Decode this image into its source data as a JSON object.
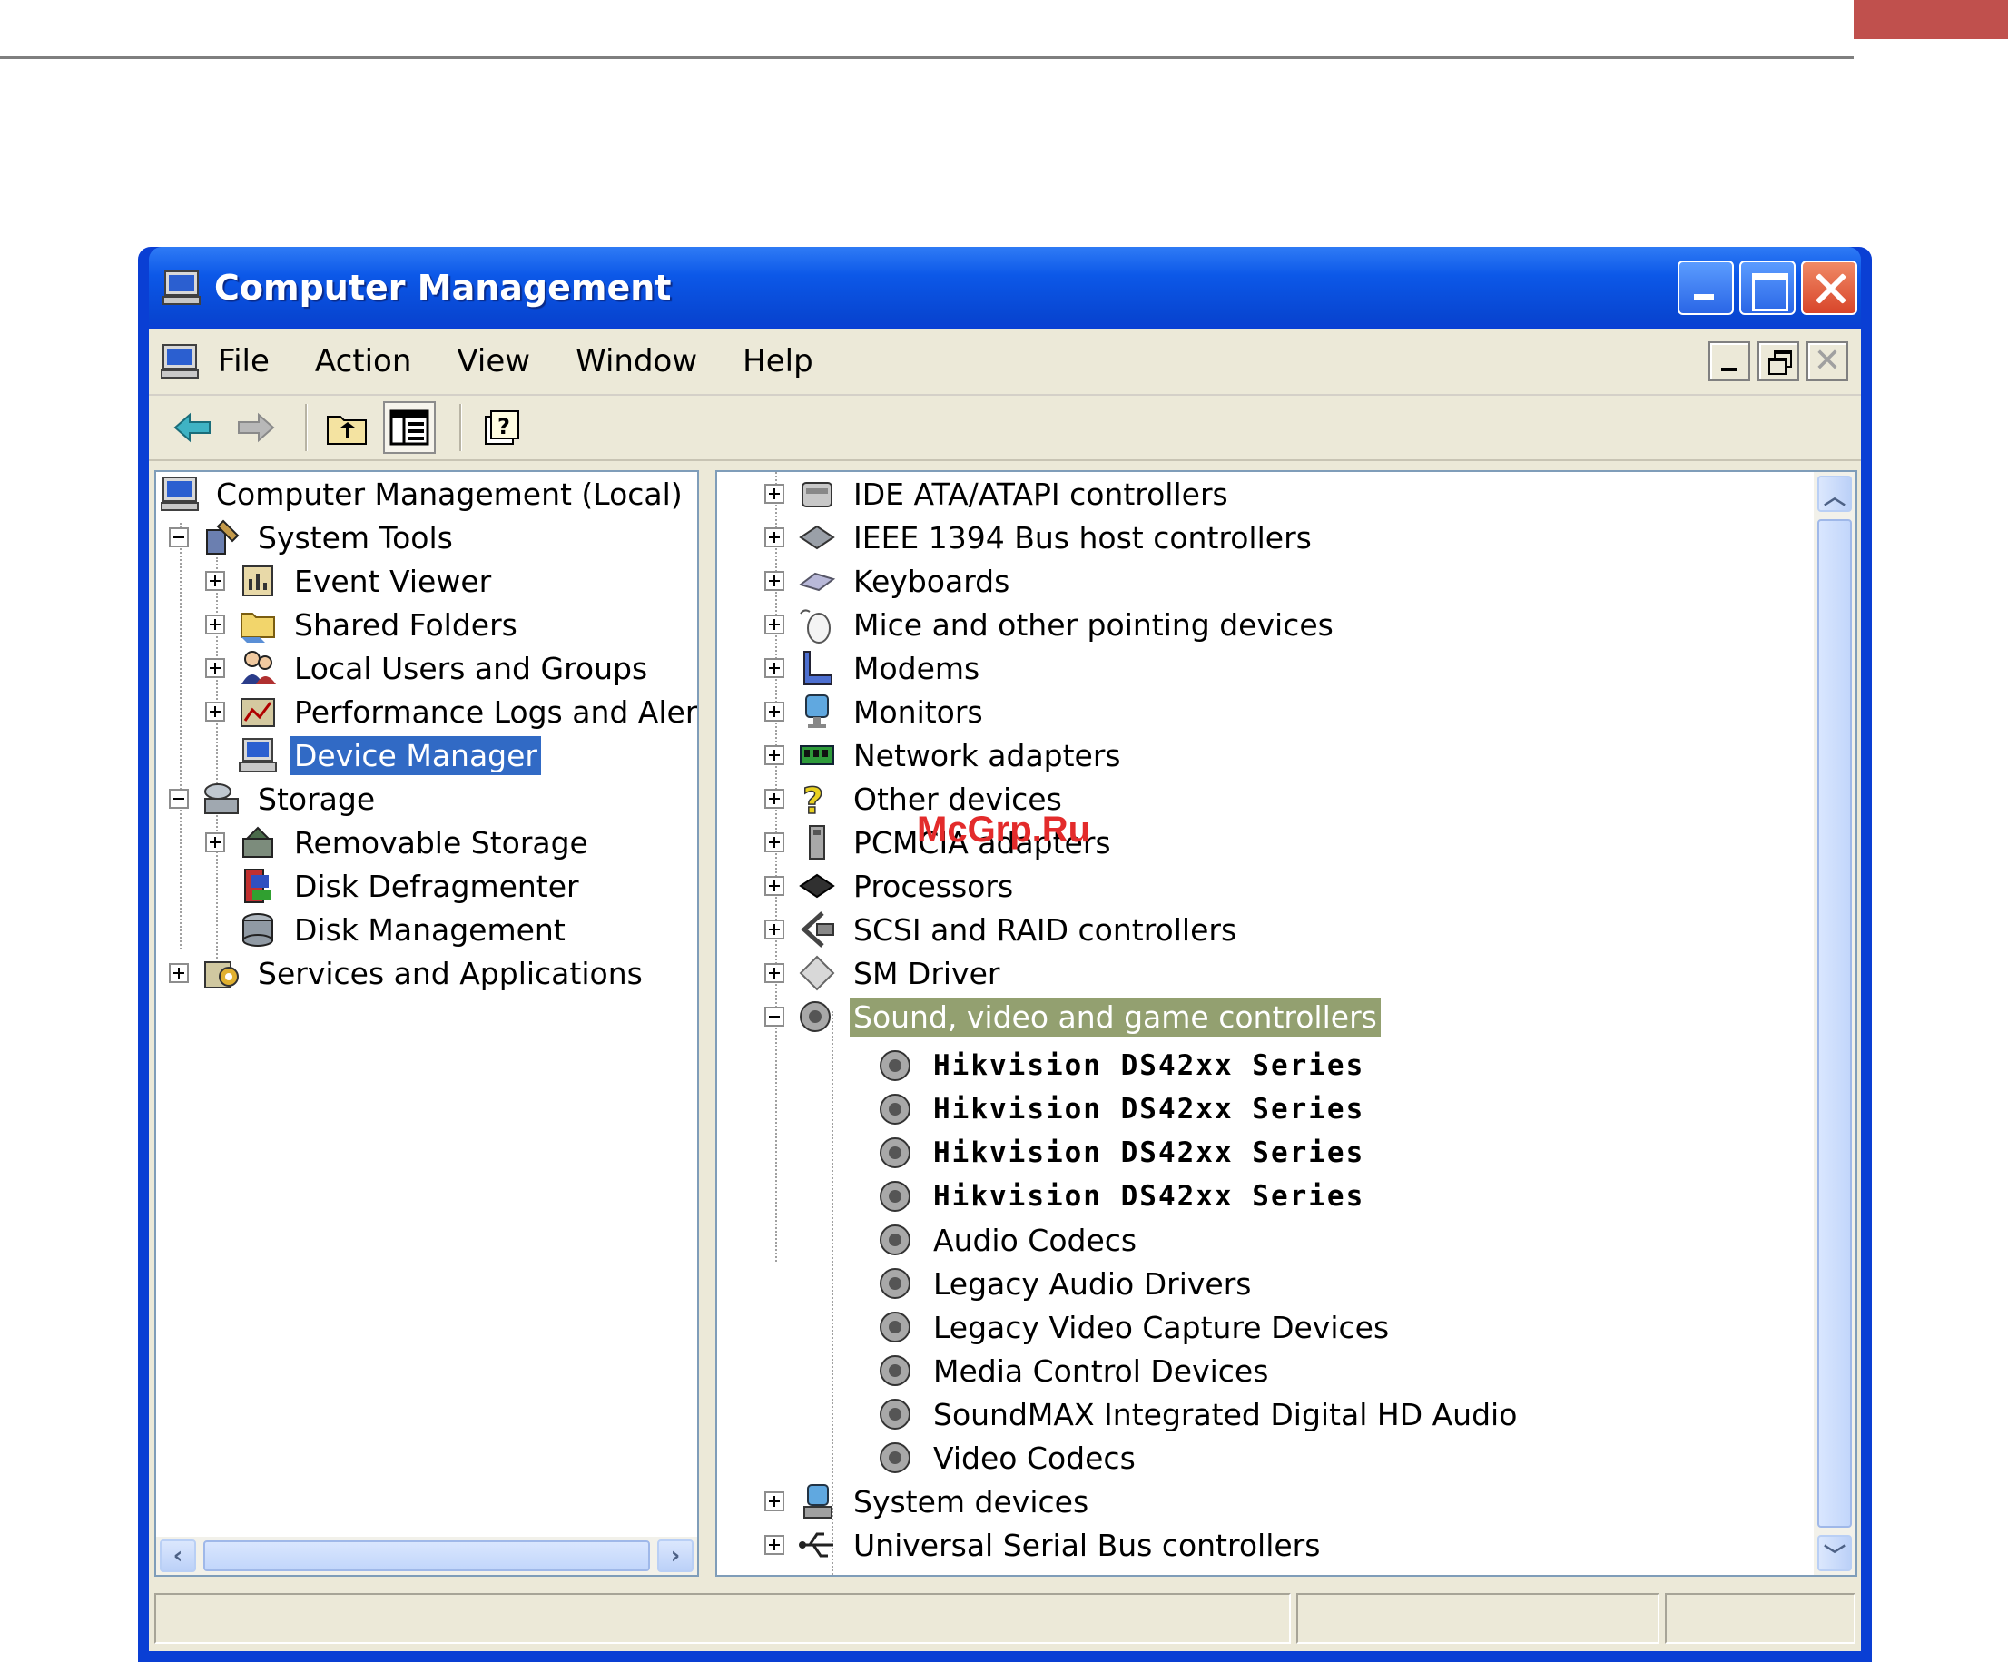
{
  "window": {
    "title": "Computer Management"
  },
  "menubar": {
    "items": [
      "File",
      "Action",
      "View",
      "Window",
      "Help"
    ]
  },
  "toolbar": {
    "buttons": [
      "back-arrow-icon",
      "forward-arrow-icon",
      "up-folder-icon",
      "show-hide-tree-icon",
      "help-icon"
    ]
  },
  "left_tree": {
    "root": "Computer Management (Local)",
    "system_tools": "System Tools",
    "event_viewer": "Event Viewer",
    "shared_folders": "Shared Folders",
    "local_users": "Local Users and Groups",
    "perf_logs": "Performance Logs and Alerts",
    "device_manager": "Device Manager",
    "storage": "Storage",
    "removable_storage": "Removable Storage",
    "disk_defrag": "Disk Defragmenter",
    "disk_mgmt": "Disk Management",
    "services_apps": "Services and Applications"
  },
  "device_tree": {
    "categories_top": [
      "IDE ATA/ATAPI controllers",
      "IEEE 1394 Bus host controllers",
      "Keyboards",
      "Mice and other pointing devices",
      "Modems",
      "Monitors",
      "Network adapters",
      "Other devices",
      "PCMCIA adapters",
      "Processors",
      "SCSI and RAID controllers",
      "SM Driver"
    ],
    "expanded_category": "Sound, video and game controllers",
    "children": [
      "Hikvision DS42xx Series",
      "Hikvision DS42xx Series",
      "Hikvision DS42xx Series",
      "Hikvision DS42xx Series",
      "Audio Codecs",
      "Legacy Audio Drivers",
      "Legacy Video Capture Devices",
      "Media Control Devices",
      "SoundMAX Integrated Digital HD Audio",
      "Video Codecs"
    ],
    "categories_bottom": [
      "System devices",
      "Universal Serial Bus controllers"
    ]
  },
  "watermark": "McGrp.Ru",
  "colors": {
    "selection_blue": "#316ac5",
    "selection_olive": "#93a070",
    "titlebar_blue": "#0a3fd4",
    "accent_red": "#c0504d"
  }
}
